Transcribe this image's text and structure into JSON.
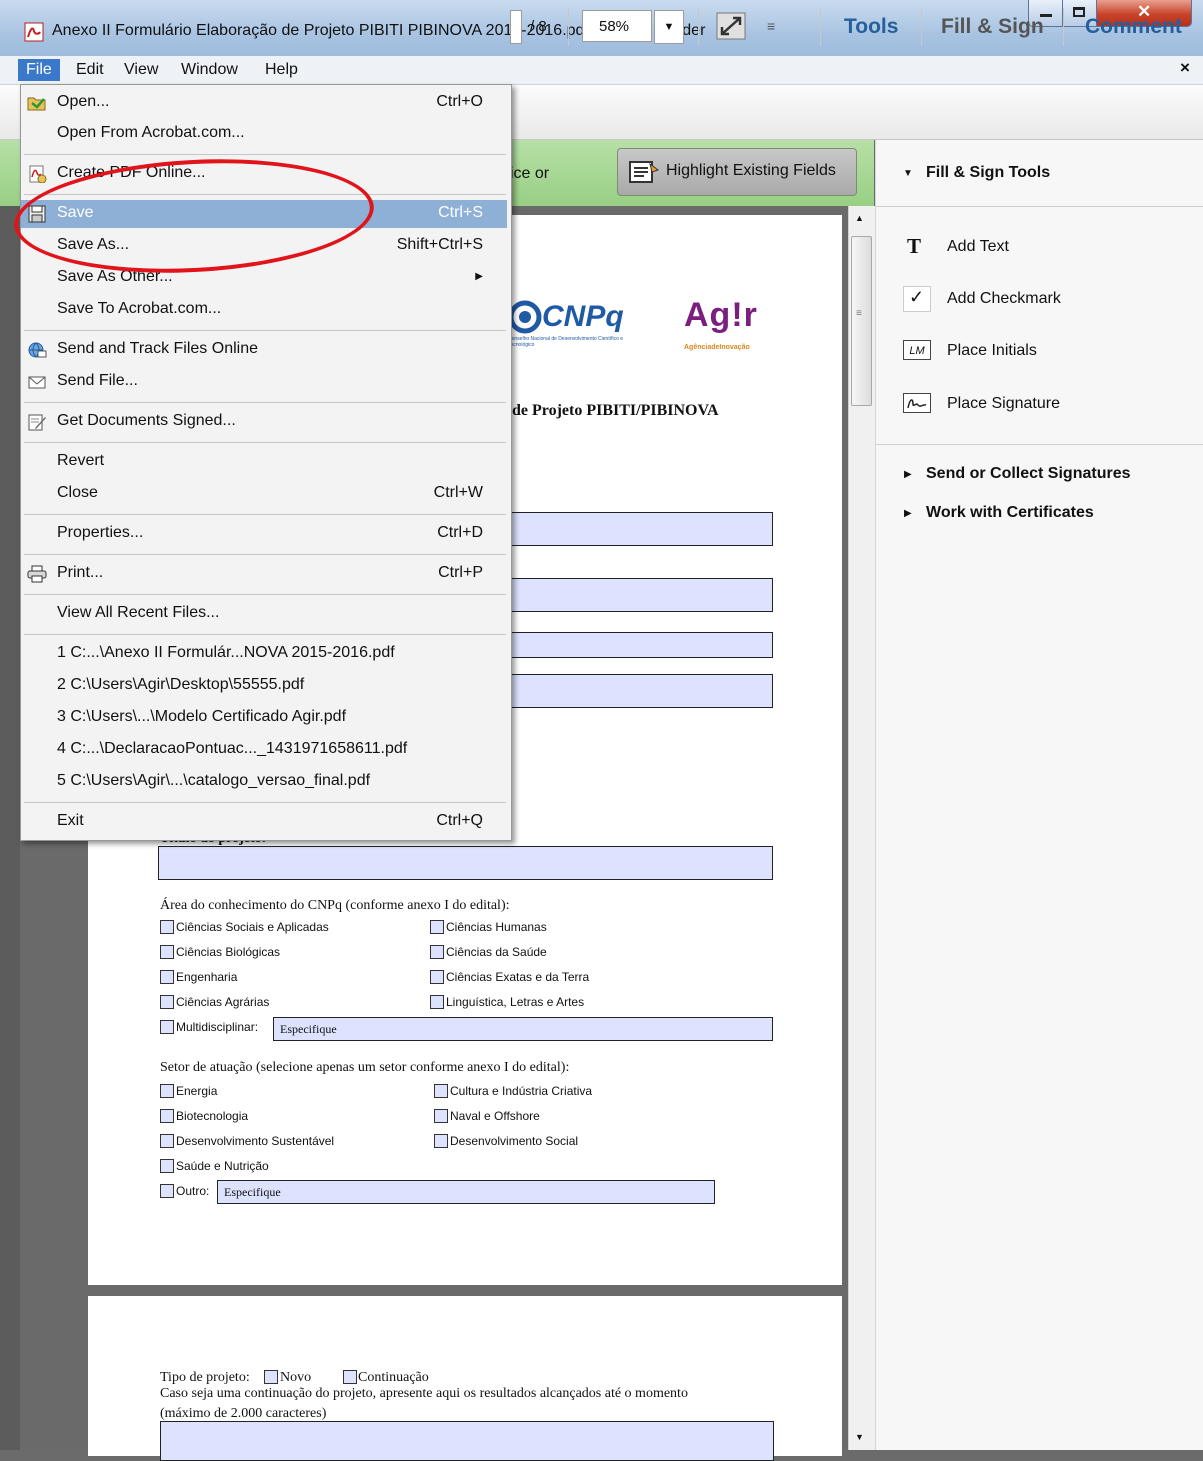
{
  "window": {
    "title": "Anexo II Formulário Elaboração de Projeto PIBITI PIBINOVA 2015-2016.pdf - Adobe Reader"
  },
  "menubar": {
    "file": "File",
    "edit": "Edit",
    "view": "View",
    "window": "Window",
    "help": "Help",
    "close": "×"
  },
  "toolbar": {
    "page_total": "/ 8",
    "zoom": "58%",
    "tools": "Tools",
    "fill_sign": "Fill & Sign",
    "comment": "Comment"
  },
  "greenbar": {
    "text": "ice or",
    "highlight_button": "Highlight Existing Fields"
  },
  "file_menu": {
    "open": {
      "label": "Open...",
      "shortcut": "Ctrl+O"
    },
    "open_acrobat": {
      "label": "Open From Acrobat.com..."
    },
    "create_pdf": {
      "label": "Create PDF Online..."
    },
    "save": {
      "label": "Save",
      "shortcut": "Ctrl+S"
    },
    "save_as": {
      "label": "Save As...",
      "shortcut": "Shift+Ctrl+S"
    },
    "save_as_other": {
      "label": "Save As Other..."
    },
    "save_acrobat": {
      "label": "Save To Acrobat.com..."
    },
    "send_track": {
      "label": "Send and Track Files Online"
    },
    "send_file": {
      "label": "Send File..."
    },
    "get_signed": {
      "label": "Get Documents Signed..."
    },
    "revert": {
      "label": "Revert"
    },
    "close": {
      "label": "Close",
      "shortcut": "Ctrl+W"
    },
    "properties": {
      "label": "Properties...",
      "shortcut": "Ctrl+D"
    },
    "print": {
      "label": "Print...",
      "shortcut": "Ctrl+P"
    },
    "view_recent": {
      "label": "View All Recent Files..."
    },
    "recent": [
      "1 C:...\\Anexo II Formulár...NOVA 2015-2016.pdf",
      "2 C:\\Users\\Agir\\Desktop\\55555.pdf",
      "3 C:\\Users\\...\\Modelo Certificado Agir.pdf",
      "4 C:...\\DeclaracaoPontuac..._1431971658611.pdf",
      "5 C:\\Users\\Agir\\...\\catalogo_versao_final.pdf"
    ],
    "exit": {
      "label": "Exit",
      "shortcut": "Ctrl+Q"
    }
  },
  "right_panel": {
    "header": "Fill & Sign Tools",
    "items": [
      "Add Text",
      "Add Checkmark",
      "Place Initials",
      "Place Signature"
    ],
    "sections": [
      "Send or Collect Signatures",
      "Work with Certificates"
    ]
  },
  "document": {
    "logo_cnpq": "CNPq",
    "logo_cnpq_sub": "Conselho Nacional de Desenvolvimento Científico e Tecnológico",
    "logo_agir": "Ag!r",
    "logo_agir_sub": "AgênciadeInovação",
    "heading_fragment": "de Projeto PIBITI/PIBINOVA",
    "title_label_fragment": "Título do projeto:",
    "area_label": "Área do conhecimento do CNPq (conforme anexo I do edital):",
    "area_left": [
      "Ciências Sociais e Aplicadas",
      "Ciências Biológicas",
      "Engenharia",
      "Ciências Agrárias",
      "Multidisciplinar:"
    ],
    "area_right": [
      "Ciências Humanas",
      "Ciências da Saúde",
      "Ciências Exatas e da Terra",
      "Linguística, Letras e Artes"
    ],
    "specify": "Especifique",
    "sector_label": "Setor de atuação (selecione apenas um setor conforme anexo I do edital):",
    "sector_left": [
      "Energia",
      "Biotecnologia",
      "Desenvolvimento Sustentável",
      "Saúde e Nutrição",
      "Outro:"
    ],
    "sector_right": [
      "Cultura e Indústria Criativa",
      "Naval e Offshore",
      "Desenvolvimento Social"
    ],
    "project_type_label": "Tipo de projeto:",
    "type_new": "Novo",
    "type_continuation": "Continuação",
    "continuation_text": "Caso seja uma continuação do projeto, apresente aqui os resultados alcançados até o momento",
    "max_chars": "(máximo de 2.000 caracteres)"
  }
}
